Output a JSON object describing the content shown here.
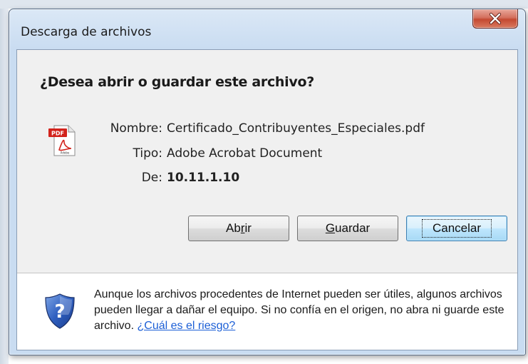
{
  "window": {
    "title": "Descarga de archivos"
  },
  "dialog": {
    "question": "¿Desea abrir o guardar este archivo?",
    "file": {
      "name_label": "Nombre:",
      "name_value": "Certificado_Contribuyentes_Especiales.pdf",
      "type_label": "Tipo:",
      "type_value": "Adobe Acrobat Document",
      "from_label": "De:",
      "from_value": "10.11.1.10"
    },
    "buttons": {
      "open": {
        "pre": "Ab",
        "accel": "r",
        "post": "ir"
      },
      "save": {
        "pre": "",
        "accel": "G",
        "post": "uardar"
      },
      "cancel": "Cancelar"
    },
    "warning": {
      "text": "Aunque los archivos procedentes de Internet pueden ser útiles, algunos archivos pueden llegar a dañar el equipo. Si no confía en el origen, no abra ni guarde este archivo.",
      "link": "¿Cuál es el riesgo?"
    }
  },
  "icons": {
    "close": "close-icon",
    "file": "pdf-file-icon",
    "security": "shield-question-icon"
  },
  "colors": {
    "close_button": "#c44a32",
    "link": "#1c5fd6",
    "default_button_border": "#3c7fb1"
  }
}
